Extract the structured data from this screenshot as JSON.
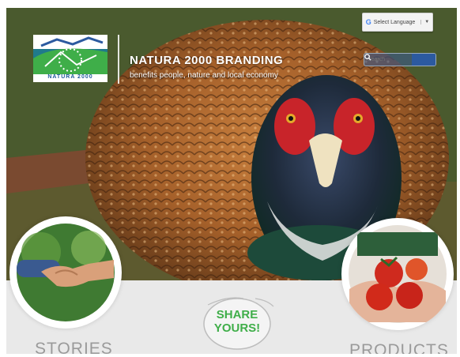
{
  "header": {
    "language_label": "Select Language",
    "language_arrow": "▼",
    "title": "NATURA 2000 BRANDING",
    "subtitle": "benefits people, nature and local economy",
    "logo_text": "NATURA 2000"
  },
  "search": {
    "placeholder": "Search",
    "button_icon": "search-icon"
  },
  "stories": {
    "label": "STORIES"
  },
  "share": {
    "line1": "SHARE",
    "line2": "YOURS!"
  },
  "products": {
    "label": "PRODUCTS"
  },
  "colors": {
    "brand_blue": "#2c5aa0",
    "brand_green": "#3fae49",
    "logo_teal": "#1f7a8c"
  }
}
